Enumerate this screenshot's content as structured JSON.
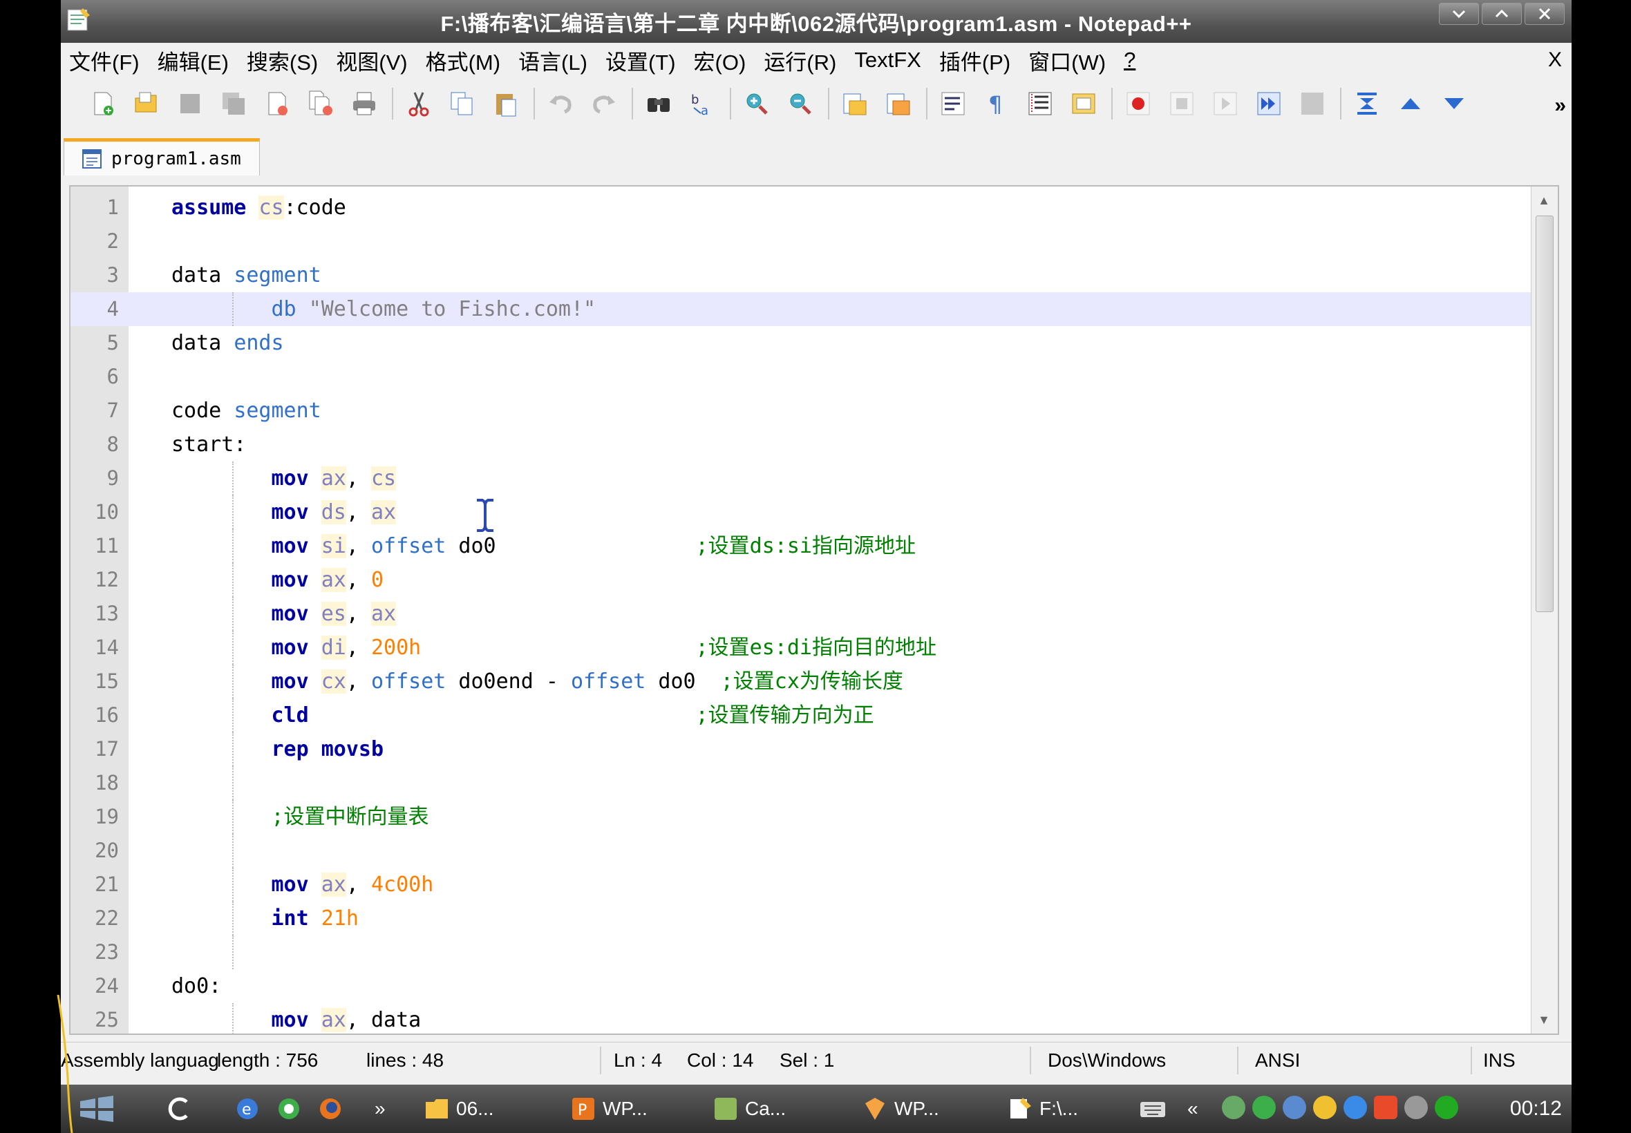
{
  "window": {
    "title": "F:\\播布客\\汇编语言\\第十二章 内中断\\062源代码\\program1.asm - Notepad++",
    "controls": [
      "minimize",
      "maximize",
      "close"
    ]
  },
  "menu": {
    "items": [
      "文件(F)",
      "编辑(E)",
      "搜索(S)",
      "视图(V)",
      "格式(M)",
      "语言(L)",
      "设置(T)",
      "宏(O)",
      "运行(R)",
      "TextFX",
      "插件(P)",
      "窗口(W)",
      "?"
    ],
    "close_label": "X"
  },
  "toolbar": {
    "more_label": "»",
    "icons": [
      "new-file-icon",
      "open-file-icon",
      "save-icon",
      "save-all-icon",
      "close-icon",
      "close-all-icon",
      "print-icon",
      "cut-icon",
      "copy-icon",
      "paste-icon",
      "undo-icon",
      "redo-icon",
      "find-icon",
      "replace-icon",
      "zoom-in-icon",
      "zoom-out-icon",
      "sync-v-icon",
      "sync-h-icon",
      "wrap-icon",
      "show-all-chars-icon",
      "indent-guide-icon",
      "user-lang-icon",
      "record-macro-icon",
      "stop-macro-icon",
      "play-macro-icon",
      "run-macro-multiple-icon",
      "save-macro-icon",
      "fold-all-icon",
      "prev-icon",
      "next-icon"
    ]
  },
  "tab": {
    "label": "program1.asm"
  },
  "editor": {
    "current_line": 4,
    "lines": [
      {
        "n": "1",
        "code": "assume cs:code"
      },
      {
        "n": "2",
        "code": ""
      },
      {
        "n": "3",
        "code": "data segment"
      },
      {
        "n": "4",
        "code": "        db \"Welcome to Fishc.com!\""
      },
      {
        "n": "5",
        "code": "data ends"
      },
      {
        "n": "6",
        "code": ""
      },
      {
        "n": "7",
        "code": "code segment"
      },
      {
        "n": "8",
        "code": "start:"
      },
      {
        "n": "9",
        "code": "        mov ax, cs"
      },
      {
        "n": "10",
        "code": "        mov ds, ax"
      },
      {
        "n": "11",
        "code": "        mov si, offset do0                ;设置ds:si指向源地址"
      },
      {
        "n": "12",
        "code": "        mov ax, 0"
      },
      {
        "n": "13",
        "code": "        mov es, ax"
      },
      {
        "n": "14",
        "code": "        mov di, 200h                      ;设置es:di指向目的地址"
      },
      {
        "n": "15",
        "code": "        mov cx, offset do0end - offset do0  ;设置cx为传输长度"
      },
      {
        "n": "16",
        "code": "        cld                               ;设置传输方向为正"
      },
      {
        "n": "17",
        "code": "        rep movsb"
      },
      {
        "n": "18",
        "code": ""
      },
      {
        "n": "19",
        "code": "        ;设置中断向量表"
      },
      {
        "n": "20",
        "code": ""
      },
      {
        "n": "21",
        "code": "        mov ax, 4c00h"
      },
      {
        "n": "22",
        "code": "        int 21h"
      },
      {
        "n": "23",
        "code": ""
      },
      {
        "n": "24",
        "code": "do0:"
      },
      {
        "n": "25",
        "code": "        mov ax, data"
      }
    ]
  },
  "status": {
    "language": "Assembly languag",
    "length": "length : 756",
    "lines": "lines : 48",
    "ln": "Ln : 4",
    "col": "Col : 14",
    "sel": "Sel : 1",
    "eol": "Dos\\Windows",
    "encoding": "ANSI",
    "mode": "INS"
  },
  "taskbar": {
    "quick_more": "»",
    "tasks": [
      "06...",
      "WP...",
      "Ca...",
      "WP...",
      "F:\\..."
    ],
    "tray_more": "«",
    "clock": "00:12"
  },
  "colors": {
    "keyword": "#0000ff",
    "directive": "#3070c8",
    "register": "#8080c0",
    "number": "#ff8000",
    "comment": "#008000",
    "current_line": "#e8e8ff"
  }
}
